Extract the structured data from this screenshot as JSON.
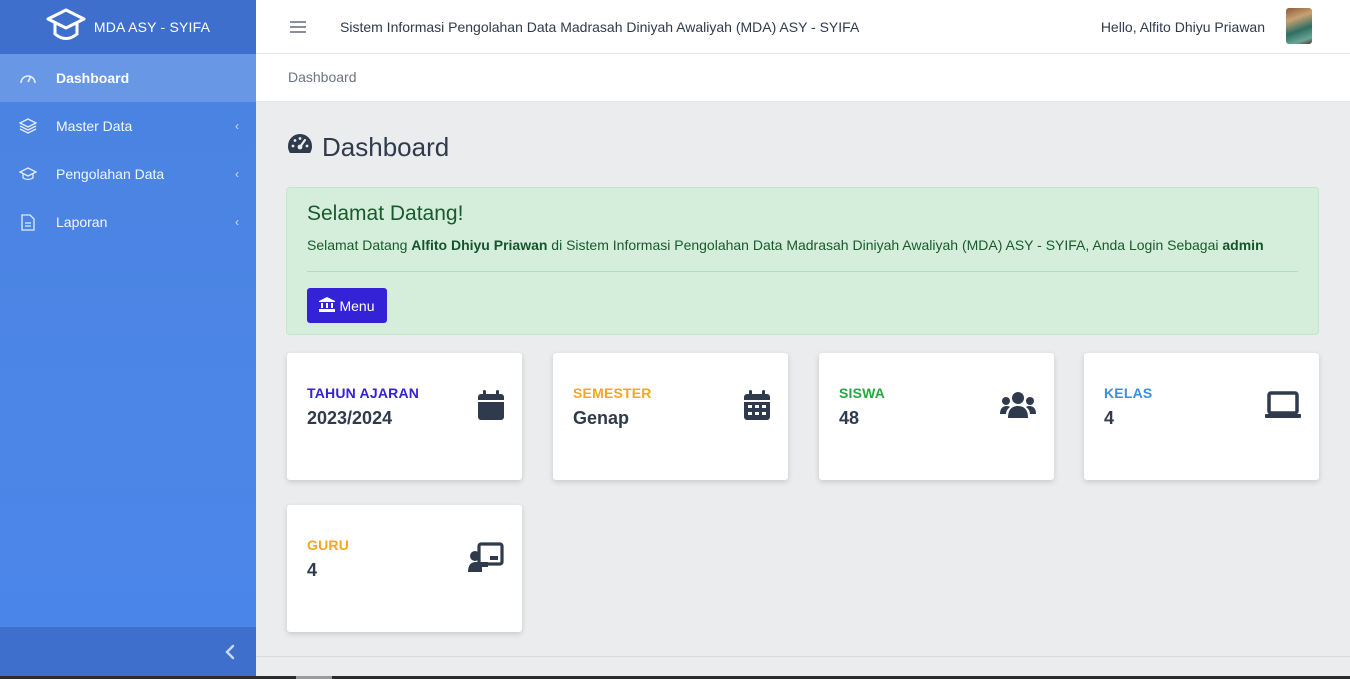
{
  "brand": {
    "name": "MDA ASY - SYIFA",
    "icon": "graduation-cap-icon"
  },
  "sidebar": {
    "items": [
      {
        "label": "Dashboard",
        "icon": "gauge-icon",
        "active": true
      },
      {
        "label": "Master Data",
        "icon": "layers-icon",
        "chevron": "‹"
      },
      {
        "label": "Pengolahan Data",
        "icon": "graduation-cap-icon",
        "chevron": "‹"
      },
      {
        "label": "Laporan",
        "icon": "file-icon",
        "chevron": "‹"
      }
    ]
  },
  "topbar": {
    "title": "Sistem Informasi Pengolahan Data Madrasah Diniyah Awaliyah (MDA) ASY - SYIFA",
    "greeting": "Hello, Alfito Dhiyu Priawan"
  },
  "breadcrumb": "Dashboard",
  "page": {
    "title": "Dashboard"
  },
  "welcome": {
    "heading": "Selamat Datang!",
    "text_1": "Selamat Datang ",
    "user": "Alfito Dhiyu Priawan",
    "text_2": " di Sistem Informasi Pengolahan Data Madrasah Diniyah Awaliyah (MDA) ASY - SYIFA, Anda Login Sebagai ",
    "role": "admin",
    "button": "Menu"
  },
  "cards": [
    {
      "label": "TAHUN AJARAN",
      "value": "2023/2024",
      "color": "#3322d6",
      "icon": "calendar-icon"
    },
    {
      "label": "SEMESTER",
      "value": "Genap",
      "color": "#f5a623",
      "icon": "calendar-grid-icon"
    },
    {
      "label": "SISWA",
      "value": "48",
      "color": "#28a745",
      "icon": "users-icon"
    },
    {
      "label": "KELAS",
      "value": "4",
      "color": "#3b8fe0",
      "icon": "laptop-icon"
    },
    {
      "label": "GURU",
      "value": "4",
      "color": "#f5a623",
      "icon": "chalkboard-teacher-icon"
    }
  ],
  "colors": {
    "sidebar": "#4a86ea",
    "accent": "#3322d6",
    "alert_bg": "#d5eedb"
  }
}
